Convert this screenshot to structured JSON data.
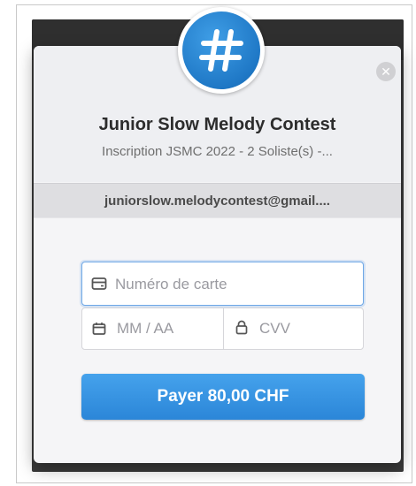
{
  "header": {
    "merchant_name": "Junior Slow Melody Contest",
    "description": "Inscription JSMC 2022 - 2 Soliste(s) -..."
  },
  "account": {
    "email": "juniorslow.melodycontest@gmail...."
  },
  "form": {
    "card_number_placeholder": "Numéro de carte",
    "expiry_placeholder": "MM / AA",
    "cvv_placeholder": "CVV"
  },
  "pay_button": {
    "label": "Payer 80,00 CHF"
  },
  "icons": {
    "logo": "hashtag-icon",
    "close": "close-icon",
    "card": "credit-card-icon",
    "calendar": "calendar-icon",
    "lock": "lock-icon"
  },
  "colors": {
    "accent": "#2f8ee0",
    "logo_blue": "#1f78c6",
    "focus_border": "#6fa8e6"
  }
}
